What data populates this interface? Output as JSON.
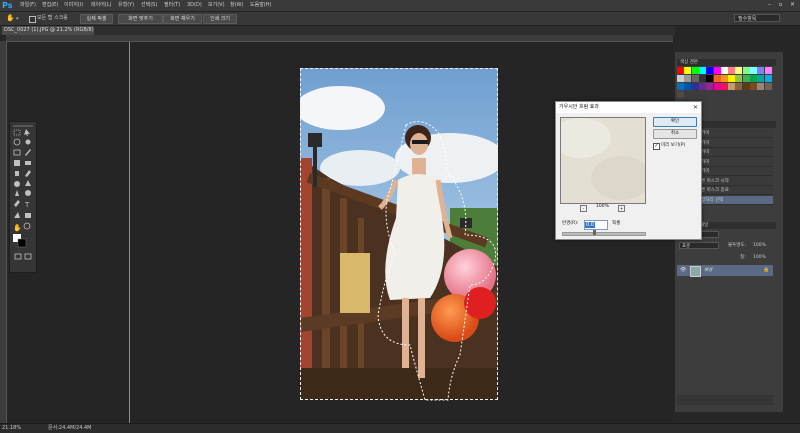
{
  "menubar": {
    "logo": "Ps",
    "items": [
      "파일(F)",
      "편집(E)",
      "이미지(I)",
      "레이어(L)",
      "유형(Y)",
      "선택(S)",
      "필터(T)",
      "3D(D)",
      "보기(V)",
      "창(W)",
      "도움말(H)"
    ]
  },
  "optionsbar": {
    "tool_option": "모든 탭 스크롤",
    "btn_actual": "실제 픽셀",
    "btn_fit": "화면 맞추기",
    "btn_fill": "화면 채우기",
    "btn_print": "인쇄 크기",
    "workspace": "필수항목"
  },
  "document": {
    "tab_label": "DSC_0027 (1).JPG @ 21.2% (RGB/8) *"
  },
  "statusbar": {
    "zoom": "21.18%",
    "doc_size": "문서:24.4M/24.4M"
  },
  "swatches_panel": {
    "title": "색상 견본",
    "colors": [
      "#ff0000",
      "#ffff00",
      "#00ff00",
      "#00ffff",
      "#0000ff",
      "#ff00ff",
      "#ffffff",
      "#ff8080",
      "#ffff80",
      "#80ff80",
      "#80ffff",
      "#8080ff",
      "#ff80ff",
      "#cccccc",
      "#999999",
      "#666666",
      "#333333",
      "#000000",
      "#f26522",
      "#f7941d",
      "#fff200",
      "#8dc63f",
      "#39b54a",
      "#00a651",
      "#00a99d",
      "#00aeef",
      "#0072bc",
      "#0054a6",
      "#2e3192",
      "#662d91",
      "#92278f",
      "#ec008c",
      "#ed145b",
      "#c69c6d",
      "#8c6239",
      "#603913",
      "#754c24",
      "#998675",
      "#736357",
      "#534741"
    ]
  },
  "history_panel": {
    "title": "작업 내역",
    "items": [
      "올가미",
      "올가미",
      "올가미",
      "올가미",
      "올가미",
      "빠른 마스크 시작",
      "빠른 마스크 종료",
      "가장자리 선택"
    ]
  },
  "layers_panel": {
    "tab": "레이어",
    "tab2": "채널",
    "kind": "종류",
    "mode": "표준",
    "opacity_label": "불투명도:",
    "opacity": "100%",
    "fill_label": "칠:",
    "fill": "100%",
    "layer_name": "배경"
  },
  "dialog": {
    "title": "가우시안 흐림 효과",
    "ok": "확인",
    "cancel": "취소",
    "preview_label": "미리 보기(P)",
    "zoom": "100%",
    "radius_label": "반경(R):",
    "radius_value": "0.0",
    "radius_unit": "픽셀",
    "zoom_in": "+",
    "zoom_out": "-"
  }
}
